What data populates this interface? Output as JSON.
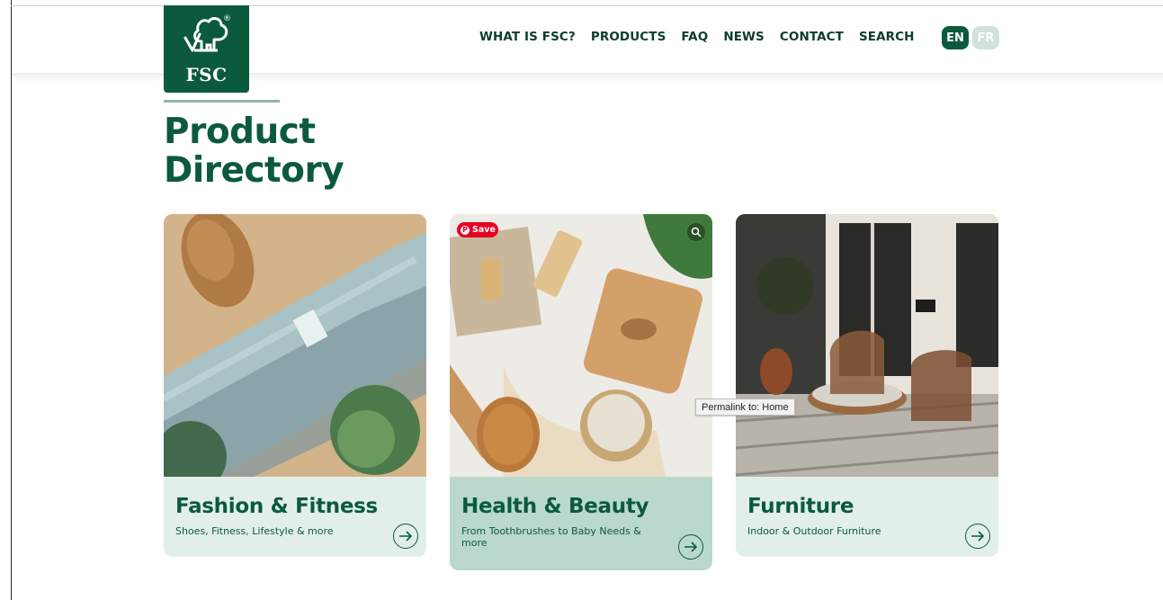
{
  "brand": {
    "logo_text": "FSC",
    "registered_mark": "®"
  },
  "nav": {
    "items": [
      "WHAT IS FSC?",
      "PRODUCTS",
      "FAQ",
      "NEWS",
      "CONTACT",
      "SEARCH"
    ],
    "lang_en": "EN",
    "lang_fr": "FR"
  },
  "page": {
    "title_line1": "Product",
    "title_line2": "Directory"
  },
  "cards": [
    {
      "title": "Fashion & Fitness",
      "subtitle": "Shoes, Fitness, Lifestyle & more"
    },
    {
      "title": "Health & Beauty",
      "subtitle": "From Toothbrushes to Baby Needs & more"
    },
    {
      "title": "Furniture",
      "subtitle": "Indoor & Outdoor Furniture"
    }
  ],
  "overlay": {
    "save_label": "Save",
    "tooltip": "Permalink to: Home"
  },
  "colors": {
    "brand_green": "#0b5a3c",
    "card_bg": "#e2efe9",
    "card_bg_hover": "#bad8cb",
    "pinterest_red": "#e60023"
  },
  "icons": [
    "fsc-tree-icon",
    "arrow-right-circle-icon",
    "pinterest-icon",
    "zoom-icon"
  ]
}
